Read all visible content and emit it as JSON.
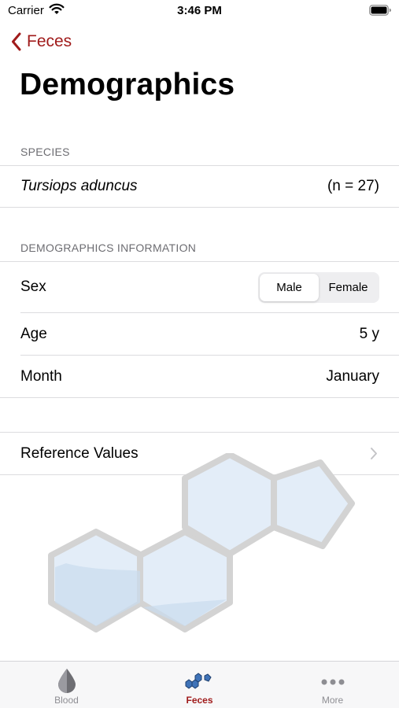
{
  "status_bar": {
    "carrier": "Carrier",
    "time": "3:46 PM"
  },
  "nav": {
    "back_label": "Feces",
    "title": "Demographics"
  },
  "species_section": {
    "header": "SPECIES",
    "name": "Tursiops aduncus",
    "count": "(n = 27)"
  },
  "demographics_section": {
    "header": "DEMOGRAPHICS INFORMATION",
    "sex_label": "Sex",
    "sex_options": [
      "Male",
      "Female"
    ],
    "sex_selected": "Male",
    "age_label": "Age",
    "age_value": "5 y",
    "month_label": "Month",
    "month_value": "January"
  },
  "reference": {
    "label": "Reference Values"
  },
  "colors": {
    "accent": "#a01b1b",
    "separator": "#dcdcdf",
    "secondary_text": "#6d6d72"
  },
  "tab_bar": {
    "tabs": [
      {
        "label": "Blood",
        "icon": "blood-drop-icon"
      },
      {
        "label": "Feces",
        "icon": "molecule-icon"
      },
      {
        "label": "More",
        "icon": "more-dots-icon"
      }
    ],
    "selected": "Feces"
  }
}
